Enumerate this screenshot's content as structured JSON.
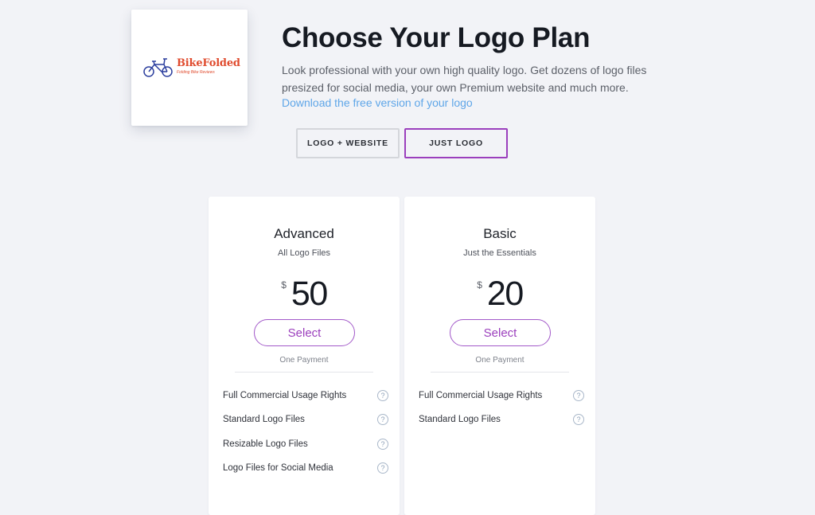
{
  "logo": {
    "brand_name": "BikeFolded",
    "brand_tagline": "Folding Bike Reviews"
  },
  "header": {
    "title": "Choose Your Logo Plan",
    "description": "Look professional with your own high quality logo. Get dozens of logo files presized for social media, your own Premium website and much more.",
    "free_link": "Download the free version of your logo"
  },
  "tabs": [
    {
      "label": "LOGO + WEBSITE",
      "selected": false
    },
    {
      "label": "JUST LOGO",
      "selected": true
    }
  ],
  "plans": [
    {
      "name": "Advanced",
      "subtitle": "All Logo Files",
      "currency": "$",
      "price": "50",
      "button": "Select",
      "payment": "One Payment",
      "features": [
        "Full Commercial Usage Rights",
        "Standard Logo Files",
        "Resizable Logo Files",
        "Logo Files for Social Media"
      ]
    },
    {
      "name": "Basic",
      "subtitle": "Just the Essentials",
      "currency": "$",
      "price": "20",
      "button": "Select",
      "payment": "One Payment",
      "features": [
        "Full Commercial Usage Rights",
        "Standard Logo Files"
      ]
    }
  ],
  "icons": {
    "help": "question-circle-icon",
    "logo": "bicycle-icon"
  },
  "colors": {
    "accent": "#9b3fbd",
    "link": "#5fa6e8",
    "brand": "#e04c2f",
    "bike": "#2c3f9e",
    "background": "#f2f3f7"
  }
}
